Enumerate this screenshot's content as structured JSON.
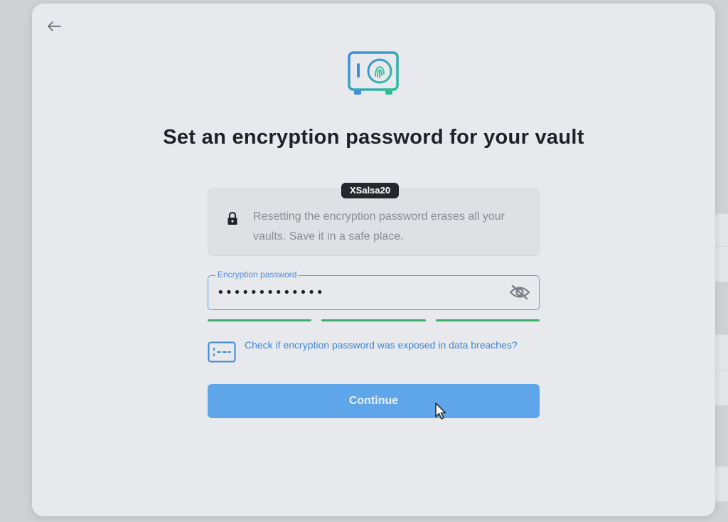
{
  "modal": {
    "back_icon": "arrow-left-icon",
    "vault_icon": "vault-fingerprint-icon",
    "title": "Set an encryption password for your vault",
    "info": {
      "tooltip": "XSalsa20",
      "lock_icon": "lock-icon",
      "text": "Resetting the encryption password erases all your vaults. Save it in a safe place."
    },
    "password": {
      "label": "Encryption password",
      "value": "•••••••••••••",
      "toggle_icon": "eye-off-icon"
    },
    "strength_segments": 3,
    "breach_link": {
      "icon": "password-check-icon",
      "text": "Check if encryption password was exposed in data breaches?"
    },
    "continue_label": "Continue"
  },
  "colors": {
    "accent": "#5ea5ea",
    "link": "#3a87d8",
    "strength": "#3fae6a",
    "modal_bg": "#e8e9ec"
  }
}
